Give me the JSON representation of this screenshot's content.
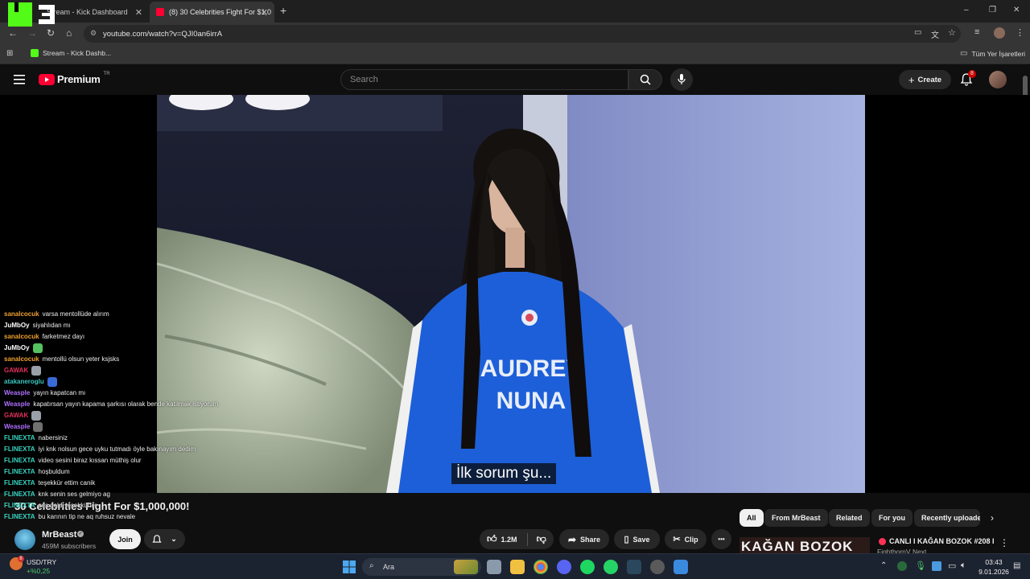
{
  "browser": {
    "tabs": [
      {
        "title": "Stream - Kick Dashboard",
        "close": "✕"
      },
      {
        "title": "(8) 30 Celebrities Fight For $1,0",
        "close": "✕"
      }
    ],
    "new_tab": "+",
    "url": "youtube.com/watch?v=QJI0an6irrA",
    "bookmarks": [
      {
        "label": "Stream - Kick Dashb..."
      }
    ],
    "all_bookmarks": "Tüm Yer İşaretleri",
    "window_controls": [
      "–",
      "❐",
      "✕"
    ]
  },
  "youtube": {
    "logo_text": "Premium",
    "logo_superscript": "TR",
    "search_placeholder": "Search",
    "create_label": "Create",
    "notifications_count": "8"
  },
  "player": {
    "subtitle": "İlk sorum şu..."
  },
  "chat": {
    "lines": [
      {
        "user": "sanalcocuk",
        "color": "#f0a030",
        "msg": "varsa mentollüde alırım"
      },
      {
        "user": "JuMbOy",
        "color": "#ffffff",
        "msg": "siyahlıdan mı"
      },
      {
        "user": "sanalcocuk",
        "color": "#f0a030",
        "msg": "farketmez dayı"
      },
      {
        "user": "JuMbOy",
        "color": "#ffffff",
        "msg": "",
        "emote": "#55c260"
      },
      {
        "user": "sanalcocuk",
        "color": "#f0a030",
        "msg": "mentollü olsun yeter ksjsks"
      },
      {
        "user": "GAWAK",
        "color": "#e0305a",
        "msg": "",
        "emote": "#9aa0aa"
      },
      {
        "user": "atakaneroglu",
        "color": "#38c6c0",
        "msg": "",
        "emote": "#3a6ad8"
      },
      {
        "user": "Weasple",
        "color": "#b070ff",
        "msg": "yayın kapatcan mı"
      },
      {
        "user": "Weasple",
        "color": "#b070ff",
        "msg": "kapatırsan yayın kapama şarkısı olarak bende katılmak istiyorum"
      },
      {
        "user": "GAWAK",
        "color": "#e0305a",
        "msg": "",
        "emote": "#9aa0aa"
      },
      {
        "user": "Weasple",
        "color": "#b070ff",
        "msg": "",
        "emote": "#707070"
      },
      {
        "user": "FLINEXTA",
        "color": "#38d4c0",
        "msg": "nabersiniz"
      },
      {
        "user": "FLINEXTA",
        "color": "#38d4c0",
        "msg": "iyi knk nolsun gece uyku tutmadı öyle bakınayım dedim"
      },
      {
        "user": "FLINEXTA",
        "color": "#38d4c0",
        "msg": "video sesini biraz kıssan müthiş olur"
      },
      {
        "user": "FLINEXTA",
        "color": "#38d4c0",
        "msg": "hoşbuldum"
      },
      {
        "user": "FLINEXTA",
        "color": "#38d4c0",
        "msg": "teşekkür ettim canik"
      },
      {
        "user": "FLINEXTA",
        "color": "#38d4c0",
        "msg": "knk senin ses gelmiyo ag"
      },
      {
        "user": "FLINEXTA",
        "color": "#38d4c0",
        "msg": "ses geldi teşekkürler"
      },
      {
        "user": "FLINEXTA",
        "color": "#38d4c0",
        "msg": "bu karının tip ne aq ruhsuz nevale"
      }
    ]
  },
  "video": {
    "title": "30 Celebrities Fight For $1,000,000!",
    "channel": "MrBeast",
    "subscribers": "459M subscribers",
    "join_label": "Join",
    "likes": "1.2M",
    "share_label": "Share",
    "save_label": "Save",
    "clip_label": "Clip",
    "more_label": "•••"
  },
  "chips": [
    "All",
    "From MrBeast",
    "Related",
    "For you",
    "Recently uploade"
  ],
  "recommended": {
    "live_title": "CANLI I KAĞAN BOZOK #208 I",
    "live_channel": "FightbornV Next",
    "thumb_text": "KAĞAN BOZOK"
  },
  "taskbar": {
    "ticker_name": "USD/TRY",
    "ticker_change": "+%0,25",
    "ticker_badge": "8",
    "search_placeholder": "Ara",
    "time": "03:43",
    "date": "9.01.2026"
  },
  "colors": {
    "accent_red": "#ff0033",
    "kick_green": "#53fc18"
  }
}
